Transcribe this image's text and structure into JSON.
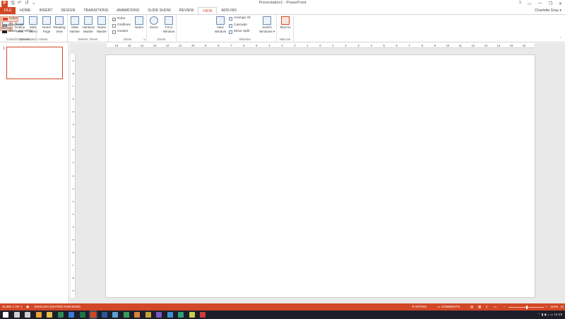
{
  "app": {
    "title": "Presentation1 - PowerPoint",
    "logo_letter": "P",
    "qat": [
      "save-icon",
      "undo-icon",
      "redo-icon",
      "customize-icon"
    ],
    "window_controls": [
      "?",
      "▭",
      "—",
      "❐",
      "✕"
    ]
  },
  "tabs": [
    "FILE",
    "HOME",
    "INSERT",
    "DESIGN",
    "TRANSITIONS",
    "ANIMATIONS",
    "SLIDE SHOW",
    "REVIEW",
    "VIEW",
    "ADD-INS"
  ],
  "active_tab": "VIEW",
  "account": "Charlotte Gray ▾",
  "ribbon": {
    "presentation_views": {
      "label": "Presentation Views",
      "buttons": [
        {
          "label": "Normal"
        },
        {
          "label": "Outline View"
        },
        {
          "label": "Slide Sorter"
        },
        {
          "label": "Notes Page"
        },
        {
          "label": "Reading View"
        }
      ]
    },
    "master_views": {
      "label": "Master Views",
      "buttons": [
        {
          "label": "Slide Master"
        },
        {
          "label": "Handout Master"
        },
        {
          "label": "Notes Master"
        }
      ]
    },
    "show": {
      "label": "Show",
      "ruler": "Ruler",
      "gridlines": "Gridlines",
      "guides": "Guides",
      "notes": "Notes"
    },
    "zoom": {
      "label": "Zoom",
      "zoom": "Zoom",
      "fit": "Fit to Window"
    },
    "color": {
      "label": "Color/Grayscale",
      "color": "Color",
      "grayscale": "Grayscale",
      "bw": "Black and White",
      "colors": {
        "color": "#d24726",
        "grayscale": "#888888",
        "bw": "#222222"
      }
    },
    "window": {
      "label": "Window",
      "new_window": "New Window",
      "arrange_all": "Arrange All",
      "cascade": "Cascade",
      "move_split": "Move Split",
      "switch": "Switch Windows ▾"
    },
    "macros": {
      "label": "Macros",
      "macros": "Macros"
    }
  },
  "thumbnail": {
    "number": "1"
  },
  "hruler_ticks": [
    "16",
    "15",
    "14",
    "13",
    "12",
    "11",
    "10",
    "9",
    "8",
    "7",
    "6",
    "5",
    "4",
    "3",
    "2",
    "1",
    "0",
    "1",
    "2",
    "3",
    "4",
    "5",
    "6",
    "7",
    "8",
    "9",
    "10",
    "11",
    "12",
    "13",
    "14",
    "15",
    "16"
  ],
  "vruler_ticks": [
    "9",
    "8",
    "7",
    "6",
    "5",
    "4",
    "3",
    "2",
    "1",
    "0",
    "1",
    "2",
    "3",
    "4",
    "5",
    "6",
    "7",
    "8",
    "9"
  ],
  "status": {
    "slide": "SLIDE 1 OF 1",
    "language": "ENGLISH (UNITED KINGDOM)",
    "notes": "≙ NOTES",
    "comments": "▭ COMMENTS",
    "zoom_minus": "−",
    "zoom_plus": "+",
    "zoom": "114%"
  },
  "taskbar": {
    "icons": [
      {
        "name": "start-icon",
        "color": "#ffffff"
      },
      {
        "name": "search-icon",
        "color": "#cfcfcf"
      },
      {
        "name": "taskview-icon",
        "color": "#cfcfcf"
      },
      {
        "name": "chrome-icon",
        "color": "#e8a33a"
      },
      {
        "name": "explorer-icon",
        "color": "#e6c14a"
      },
      {
        "name": "excel-icon",
        "color": "#2e8b57"
      },
      {
        "name": "app-icon-1",
        "color": "#3a7bd5"
      },
      {
        "name": "excel-icon-2",
        "color": "#217346"
      },
      {
        "name": "powerpoint-icon",
        "color": "#d24726"
      },
      {
        "name": "word-icon",
        "color": "#2b579a"
      },
      {
        "name": "app-icon-2",
        "color": "#5aa0d8"
      },
      {
        "name": "app-icon-3",
        "color": "#3c9a5f"
      },
      {
        "name": "app-icon-4",
        "color": "#d8843a"
      },
      {
        "name": "app-icon-5",
        "color": "#c6a23a"
      },
      {
        "name": "app-icon-6",
        "color": "#7a56c8"
      },
      {
        "name": "app-icon-7",
        "color": "#3f8fd0"
      },
      {
        "name": "app-icon-8",
        "color": "#2aa27b"
      },
      {
        "name": "app-icon-9",
        "color": "#c8d04a"
      },
      {
        "name": "app-icon-10",
        "color": "#d03a3a"
      }
    ],
    "time": "14:29"
  }
}
